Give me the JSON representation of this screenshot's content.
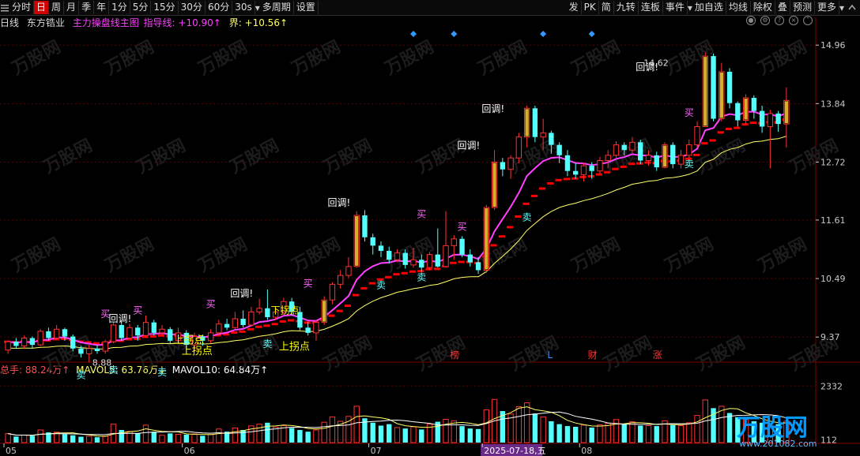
{
  "toolbar": {
    "left_items": [
      {
        "label": "分时",
        "active": false
      },
      {
        "label": "日",
        "active": true
      },
      {
        "label": "周",
        "active": false
      },
      {
        "label": "月",
        "active": false
      },
      {
        "label": "季",
        "active": false
      },
      {
        "label": "年",
        "active": false
      },
      {
        "label": "1分",
        "active": false
      },
      {
        "label": "5分",
        "active": false
      },
      {
        "label": "15分",
        "active": false
      },
      {
        "label": "30分",
        "active": false
      },
      {
        "label": "60分",
        "active": false
      },
      {
        "label": "30s",
        "active": false,
        "dropdown": true
      },
      {
        "label": "多周期",
        "active": false
      },
      {
        "label": "设置",
        "active": false
      }
    ],
    "right_items": [
      {
        "label": "发"
      },
      {
        "label": "PK"
      },
      {
        "label": "简"
      },
      {
        "label": "九转"
      },
      {
        "label": "连板"
      },
      {
        "label": "事件",
        "dropdown": true
      },
      {
        "label": "加自选"
      },
      {
        "label": "均线"
      },
      {
        "label": "除权"
      },
      {
        "label": "叠"
      },
      {
        "label": "预测"
      },
      {
        "label": "更多",
        "dropdown": true
      }
    ]
  },
  "info": {
    "period": "日线",
    "stock": "东方锆业",
    "indicator": "主力操盘线主图",
    "guide_label": "指导线: +10.90↑",
    "bound_label": "界: +10.56↑"
  },
  "volume_info": {
    "total": "总手: 88.24万↑",
    "mavol5": "MAVOL5: 63.76万↓",
    "mavol10": "MAVOL10: 64.84万↑"
  },
  "colors": {
    "up": "#ff3232",
    "down": "#54ffff",
    "guide": "#ff40ff",
    "bound": "#ffff66",
    "step": "#ff0000",
    "buy": "#ff66ff",
    "sell": "#66ffff",
    "annot": "#ffffff",
    "uturn": "#ffff00",
    "grid": "#5a0000",
    "axis": "#c8c8c8",
    "diamond": "#3399ff",
    "event": "#ff3333"
  },
  "chart_data": {
    "type": "candlestick",
    "price_axis": {
      "ticks": [
        14.96,
        13.84,
        12.72,
        11.61,
        10.49,
        9.37
      ],
      "range": [
        8.95,
        15.25
      ]
    },
    "volume_axis": {
      "ticks": [
        "2332",
        "112"
      ],
      "range": [
        0,
        2700
      ]
    },
    "x_labels": [
      {
        "text": "05",
        "index": 0
      },
      {
        "text": "06",
        "index": 22
      },
      {
        "text": "07",
        "index": 45
      },
      {
        "text": "2025-07-18,五",
        "index": 59,
        "highlight": true
      },
      {
        "text": "08",
        "index": 71
      }
    ],
    "candles": [
      [
        9.12,
        9.28,
        9.3,
        9.05,
        370
      ],
      [
        9.28,
        9.2,
        9.35,
        9.15,
        250
      ],
      [
        9.2,
        9.35,
        9.4,
        9.15,
        310
      ],
      [
        9.35,
        9.22,
        9.38,
        9.15,
        280
      ],
      [
        9.22,
        9.48,
        9.52,
        9.2,
        520
      ],
      [
        9.48,
        9.35,
        9.55,
        9.3,
        420
      ],
      [
        9.35,
        9.52,
        9.6,
        9.32,
        430
      ],
      [
        9.52,
        9.38,
        9.55,
        9.3,
        350
      ],
      [
        9.38,
        9.15,
        9.42,
        9.1,
        300
      ],
      [
        9.15,
        9.05,
        9.2,
        8.98,
        240
      ],
      [
        9.05,
        9.15,
        9.22,
        8.88,
        260
      ],
      [
        9.15,
        9.1,
        9.22,
        9.05,
        220
      ],
      [
        9.1,
        9.28,
        9.32,
        9.05,
        270
      ],
      [
        9.28,
        9.6,
        9.66,
        9.25,
        760
      ],
      [
        9.6,
        9.35,
        9.66,
        9.3,
        520
      ],
      [
        9.35,
        9.55,
        9.62,
        9.32,
        460
      ],
      [
        9.55,
        9.4,
        9.6,
        9.3,
        380
      ],
      [
        9.4,
        9.65,
        9.78,
        9.36,
        720
      ],
      [
        9.65,
        9.45,
        9.7,
        9.4,
        450
      ],
      [
        9.45,
        9.52,
        9.6,
        9.4,
        300
      ],
      [
        9.52,
        9.3,
        9.56,
        9.25,
        380
      ],
      [
        9.3,
        9.45,
        9.55,
        9.28,
        340
      ],
      [
        9.45,
        9.22,
        9.5,
        9.15,
        330
      ],
      [
        9.22,
        9.38,
        9.45,
        9.1,
        360
      ],
      [
        9.38,
        9.3,
        9.42,
        9.2,
        280
      ],
      [
        9.3,
        9.45,
        9.52,
        9.25,
        330
      ],
      [
        9.45,
        9.62,
        9.7,
        9.4,
        560
      ],
      [
        9.62,
        9.55,
        9.72,
        9.5,
        450
      ],
      [
        9.55,
        9.72,
        9.85,
        9.52,
        600
      ],
      [
        9.72,
        9.6,
        9.88,
        9.55,
        520
      ],
      [
        9.6,
        9.85,
        9.95,
        9.58,
        690
      ],
      [
        9.85,
        9.92,
        10.1,
        9.8,
        760
      ],
      [
        9.92,
        9.75,
        10.28,
        9.7,
        820
      ],
      [
        9.75,
        9.85,
        9.95,
        9.7,
        640
      ],
      [
        9.85,
        10.05,
        10.12,
        9.8,
        700
      ],
      [
        10.05,
        9.85,
        10.12,
        9.78,
        600
      ],
      [
        9.85,
        9.55,
        9.95,
        9.5,
        520
      ],
      [
        9.55,
        9.45,
        9.66,
        9.4,
        450
      ],
      [
        9.45,
        9.65,
        9.7,
        9.3,
        520
      ],
      [
        9.65,
        10.08,
        10.15,
        9.6,
        840
      ],
      [
        10.08,
        10.38,
        10.42,
        10.0,
        1060
      ],
      [
        10.38,
        10.55,
        10.65,
        10.3,
        880
      ],
      [
        10.55,
        10.72,
        10.9,
        10.5,
        1080
      ],
      [
        10.72,
        11.7,
        11.78,
        10.7,
        1500
      ],
      [
        11.7,
        11.28,
        11.8,
        11.2,
        1000
      ],
      [
        11.28,
        11.12,
        11.35,
        10.95,
        820
      ],
      [
        11.12,
        11.02,
        11.2,
        10.9,
        700
      ],
      [
        11.02,
        10.85,
        11.1,
        10.78,
        760
      ],
      [
        10.85,
        10.98,
        11.05,
        10.8,
        620
      ],
      [
        10.98,
        10.75,
        11.05,
        10.68,
        580
      ],
      [
        10.75,
        10.85,
        11.08,
        10.7,
        650
      ],
      [
        10.85,
        10.7,
        10.95,
        10.62,
        540
      ],
      [
        10.7,
        10.95,
        11.0,
        10.65,
        760
      ],
      [
        10.95,
        10.72,
        11.45,
        10.7,
        860
      ],
      [
        10.72,
        11.12,
        11.78,
        10.7,
        960
      ],
      [
        11.12,
        11.25,
        11.32,
        10.85,
        900
      ],
      [
        11.25,
        10.95,
        11.3,
        10.9,
        680
      ],
      [
        10.95,
        10.8,
        11.05,
        10.72,
        580
      ],
      [
        10.8,
        10.65,
        10.9,
        10.58,
        560
      ],
      [
        10.65,
        11.85,
        11.9,
        10.6,
        1350
      ],
      [
        11.85,
        12.72,
        12.95,
        11.8,
        1780
      ],
      [
        12.72,
        12.58,
        12.8,
        12.45,
        1300
      ],
      [
        12.58,
        12.8,
        12.85,
        12.4,
        1180
      ],
      [
        12.8,
        13.2,
        13.28,
        12.7,
        1480
      ],
      [
        13.2,
        13.75,
        13.8,
        13.0,
        1640
      ],
      [
        13.75,
        13.2,
        13.8,
        13.1,
        1200
      ],
      [
        13.2,
        13.28,
        13.55,
        12.95,
        1060
      ],
      [
        13.28,
        13.05,
        13.32,
        12.88,
        880
      ],
      [
        13.05,
        12.85,
        13.1,
        12.7,
        760
      ],
      [
        12.85,
        12.55,
        12.95,
        12.45,
        680
      ],
      [
        12.55,
        12.48,
        12.7,
        12.4,
        650
      ],
      [
        12.48,
        12.65,
        12.7,
        12.35,
        720
      ],
      [
        12.65,
        12.55,
        12.72,
        12.4,
        620
      ],
      [
        12.55,
        12.75,
        12.82,
        12.5,
        730
      ],
      [
        12.75,
        12.85,
        12.95,
        12.6,
        800
      ],
      [
        12.85,
        13.05,
        13.12,
        12.75,
        950
      ],
      [
        13.05,
        12.95,
        13.1,
        12.85,
        780
      ],
      [
        12.95,
        13.1,
        13.2,
        12.9,
        860
      ],
      [
        13.1,
        12.75,
        13.15,
        12.68,
        700
      ],
      [
        12.75,
        12.85,
        12.95,
        12.65,
        700
      ],
      [
        12.85,
        12.62,
        12.92,
        12.55,
        680
      ],
      [
        12.62,
        13.05,
        13.1,
        12.6,
        900
      ],
      [
        13.05,
        12.68,
        13.1,
        12.6,
        720
      ],
      [
        12.68,
        12.85,
        12.95,
        12.6,
        700
      ],
      [
        12.85,
        13.05,
        13.15,
        12.8,
        820
      ],
      [
        13.05,
        13.4,
        13.5,
        13.0,
        1120
      ],
      [
        13.4,
        14.75,
        14.82,
        13.4,
        1760
      ],
      [
        14.75,
        13.55,
        14.8,
        13.5,
        1420
      ],
      [
        13.55,
        14.45,
        14.62,
        13.5,
        1500
      ],
      [
        14.45,
        13.85,
        14.52,
        13.75,
        1220
      ],
      [
        13.85,
        13.52,
        13.88,
        13.4,
        1050
      ],
      [
        13.52,
        13.95,
        14.02,
        13.45,
        950
      ],
      [
        13.95,
        13.7,
        14.0,
        13.55,
        880
      ],
      [
        13.7,
        13.4,
        13.8,
        13.28,
        820
      ],
      [
        13.4,
        13.65,
        13.72,
        12.6,
        700
      ],
      [
        13.65,
        13.45,
        13.7,
        13.3,
        760
      ],
      [
        13.45,
        13.9,
        14.15,
        13.0,
        882
      ]
    ],
    "guide_line_label": "指导线",
    "bound_line_label": "界",
    "labels_buy": [
      {
        "text": "买",
        "index": 12,
        "price": 9.75
      },
      {
        "text": "买",
        "index": 16,
        "price": 9.82
      },
      {
        "text": "买",
        "index": 25,
        "price": 9.94
      },
      {
        "text": "买",
        "index": 37,
        "price": 10.33
      },
      {
        "text": "买",
        "index": 51,
        "price": 11.66
      },
      {
        "text": "买",
        "index": 56,
        "price": 11.42
      },
      {
        "text": "买",
        "index": 84,
        "price": 13.6
      }
    ],
    "labels_sell": [
      {
        "text": "卖",
        "index": 9,
        "price": 8.58
      },
      {
        "text": "卖",
        "index": 13,
        "price": 8.68
      },
      {
        "text": "卖",
        "index": 19,
        "price": 8.63
      },
      {
        "text": "卖",
        "index": 32,
        "price": 9.18
      },
      {
        "text": "卖",
        "index": 46,
        "price": 10.3
      },
      {
        "text": "卖",
        "index": 51,
        "price": 10.45
      },
      {
        "text": "卖",
        "index": 64,
        "price": 11.6
      },
      {
        "text": "卖",
        "index": 84,
        "price": 12.62
      }
    ],
    "labels_pullback": [
      {
        "text": "回调!",
        "index": 13,
        "price": 9.66
      },
      {
        "text": "回调!",
        "index": 28,
        "price": 10.14
      },
      {
        "text": "回调!",
        "index": 40,
        "price": 11.88
      },
      {
        "text": "回调!",
        "index": 56,
        "price": 12.98
      },
      {
        "text": "回调!",
        "index": 59,
        "price": 13.68
      },
      {
        "text": "回调!",
        "index": 78,
        "price": 14.48
      }
    ],
    "labels_turn_up": [
      {
        "text": "上拐点",
        "index": 21,
        "price": 9.25
      },
      {
        "text": "上拐点",
        "index": 22,
        "price": 9.04
      },
      {
        "text": "上拐点",
        "index": 34,
        "price": 9.12
      }
    ],
    "labels_turn_down": [
      {
        "text": "下拐点",
        "index": 33,
        "price": 9.82
      }
    ],
    "price_annotations": [
      {
        "text": "8.88",
        "index": 10,
        "price": 8.88
      },
      {
        "text": "14.62",
        "index": 78,
        "price": 14.62
      }
    ],
    "event_marks": [
      {
        "text": "榜",
        "index": 55
      },
      {
        "text": "L",
        "index": 67
      },
      {
        "text": "财",
        "index": 72
      },
      {
        "text": "涨",
        "index": 80
      }
    ],
    "diamond_indices": [
      50,
      55,
      66,
      72
    ],
    "watermark": "万股网",
    "watermark_url": "www.201082.com"
  }
}
